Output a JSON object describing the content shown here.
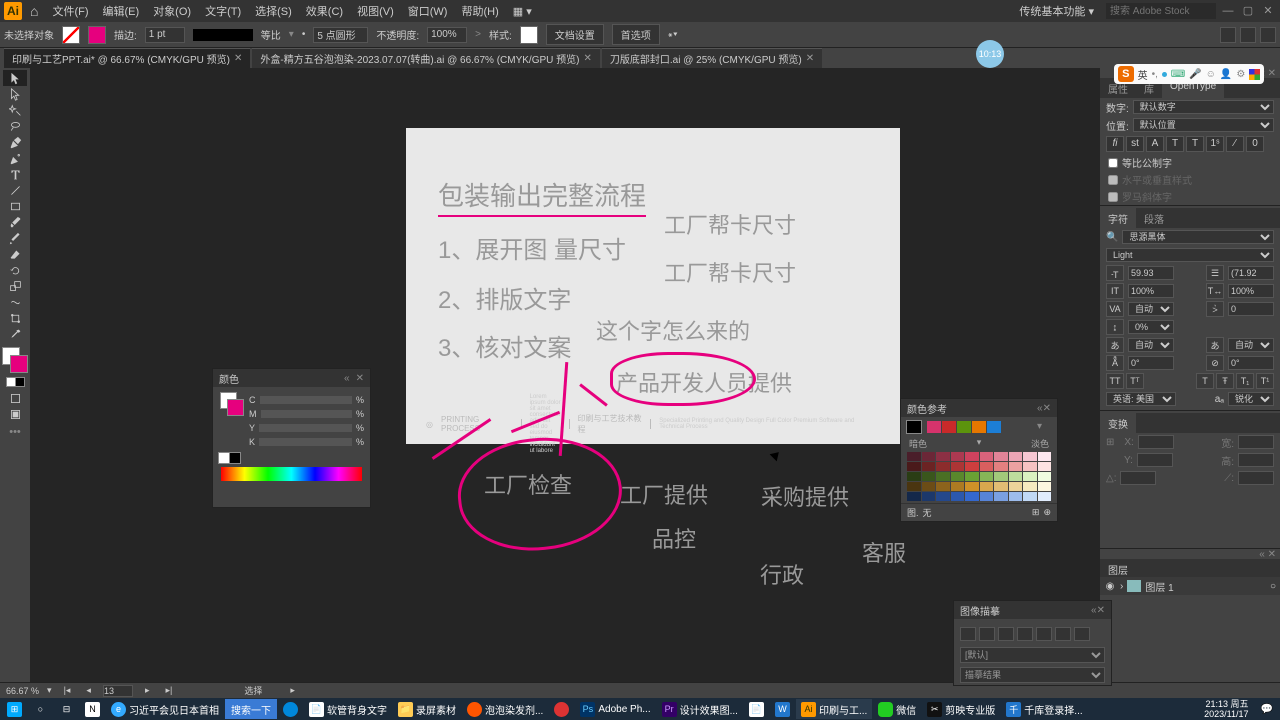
{
  "menu": {
    "items": [
      "文件(F)",
      "编辑(E)",
      "对象(O)",
      "文字(T)",
      "选择(S)",
      "效果(C)",
      "视图(V)",
      "窗口(W)",
      "帮助(H)"
    ],
    "workspace": "传统基本功能",
    "search_ph": "搜索 Adobe Stock"
  },
  "ctrl": {
    "nosel": "未选择对象",
    "strokeLbl": "描边:",
    "strokeVal": "1 pt",
    "uniLbl": "等比",
    "ptVal": "5 点圆形",
    "opLbl": "不透明度:",
    "opVal": "100%",
    "styleLbl": "样式:",
    "docset": "文档设置",
    "pref": "首选项"
  },
  "tabs": [
    {
      "t": "印刷与工艺PPT.ai* @ 66.67% (CMYK/GPU 预览)",
      "a": true
    },
    {
      "t": "外盒-精方五谷泡泡染-2023.07.07(转曲).ai @ 66.67% (CMYK/GPU 预览)",
      "a": false
    },
    {
      "t": "刀版底部封口.ai @ 25% (CMYK/GPU 预览)",
      "a": false
    }
  ],
  "art": {
    "title": "包装输出完整流程",
    "t1": "1、展开图  量尺寸",
    "t2": "2、排版文字",
    "t3": "3、核对文案",
    "t4": "工厂帮卡尺寸",
    "t5": "工厂帮卡尺寸",
    "t6": "这个字怎么来的",
    "t7": "产品开发人员提供",
    "foot1": "PRINTING PROCESS",
    "foot3": "印刷与工艺技术教程"
  },
  "free": {
    "f1": "工厂检查",
    "f2": "工厂提供",
    "f3": "采购提供",
    "f4": "品控",
    "f5": "行政",
    "f6": "客服"
  },
  "colorPanel": {
    "title": "颜色",
    "c": "C",
    "m": "M",
    "y": "Y",
    "k": "K"
  },
  "guidePanel": {
    "title": "颜色参考",
    "dark": "暗色",
    "light": "淡色",
    "ftL": "图.",
    "ftR": "无"
  },
  "tracePanel": {
    "title": "图像描摹",
    "preset": "[默认]",
    "view": "描摹结果"
  },
  "rp": {
    "tab1": "属性",
    "tab2": "库",
    "tab3": "OpenType",
    "numLbl": "数字:",
    "numVal": "默认数字",
    "posLbl": "位置:",
    "posVal": "默认位置",
    "chk1": "等比公制字",
    "chk2": "水平或垂直样式",
    "chk3": "罗马斜体字",
    "charTab": "字符",
    "paraTab": "段落",
    "font": "思源黑体",
    "weight": "Light",
    "size": "59.93",
    "lead": "(71.92",
    "scaleV": "100%",
    "scaleH": "100%",
    "track": "自动",
    "kern": "0",
    "baseline": "0%",
    "aki1": "自动",
    "aki2": "自动",
    "rot": "0°",
    "rot2": "0°",
    "lang": "英语: 美国",
    "aa": "锐化",
    "trans": "变换",
    "layerTab": "图层",
    "layer1": "图层 1"
  },
  "status": {
    "zoom": "66.67 %",
    "artb": "13",
    "sel": "选择"
  },
  "task": {
    "items": [
      "习近平会见日本首相",
      "搜索一下",
      "软管背身文字",
      "录屏素材",
      "泡泡染发剂...",
      "Adobe Ph...",
      "设计效果图...",
      "印刷与工...",
      "微信",
      "剪映专业版",
      "千库登录择..."
    ],
    "time": "21:13 周五",
    "date": "2023/11/17"
  },
  "badge": "10:13"
}
